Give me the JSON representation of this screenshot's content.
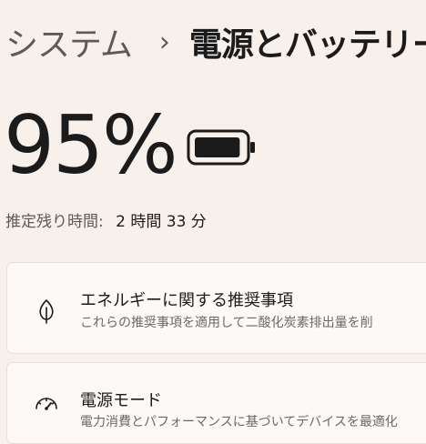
{
  "breadcrumb": {
    "parent": "システム",
    "separator": "›",
    "current": "電源とバッテリー"
  },
  "battery": {
    "percent_text": "95%",
    "level": 0.95,
    "remaining_label": "推定残り時間:",
    "remaining_value": "2 時間 33 分"
  },
  "cards": {
    "recommendations": {
      "icon": "leaf-icon",
      "title": "エネルギーに関する推奨事項",
      "description": "これらの推奨事項を適用して二酸化炭素排出量を削"
    },
    "power_mode": {
      "icon": "gauge-icon",
      "title": "電源モード",
      "description": "電力消費とパフォーマンスに基づいてデバイスを最適化"
    }
  },
  "colors": {
    "background": "#f7f0eb",
    "card": "#fcf9f7",
    "text": "#1b1b1b",
    "secondary_text": "#5f5a57"
  }
}
